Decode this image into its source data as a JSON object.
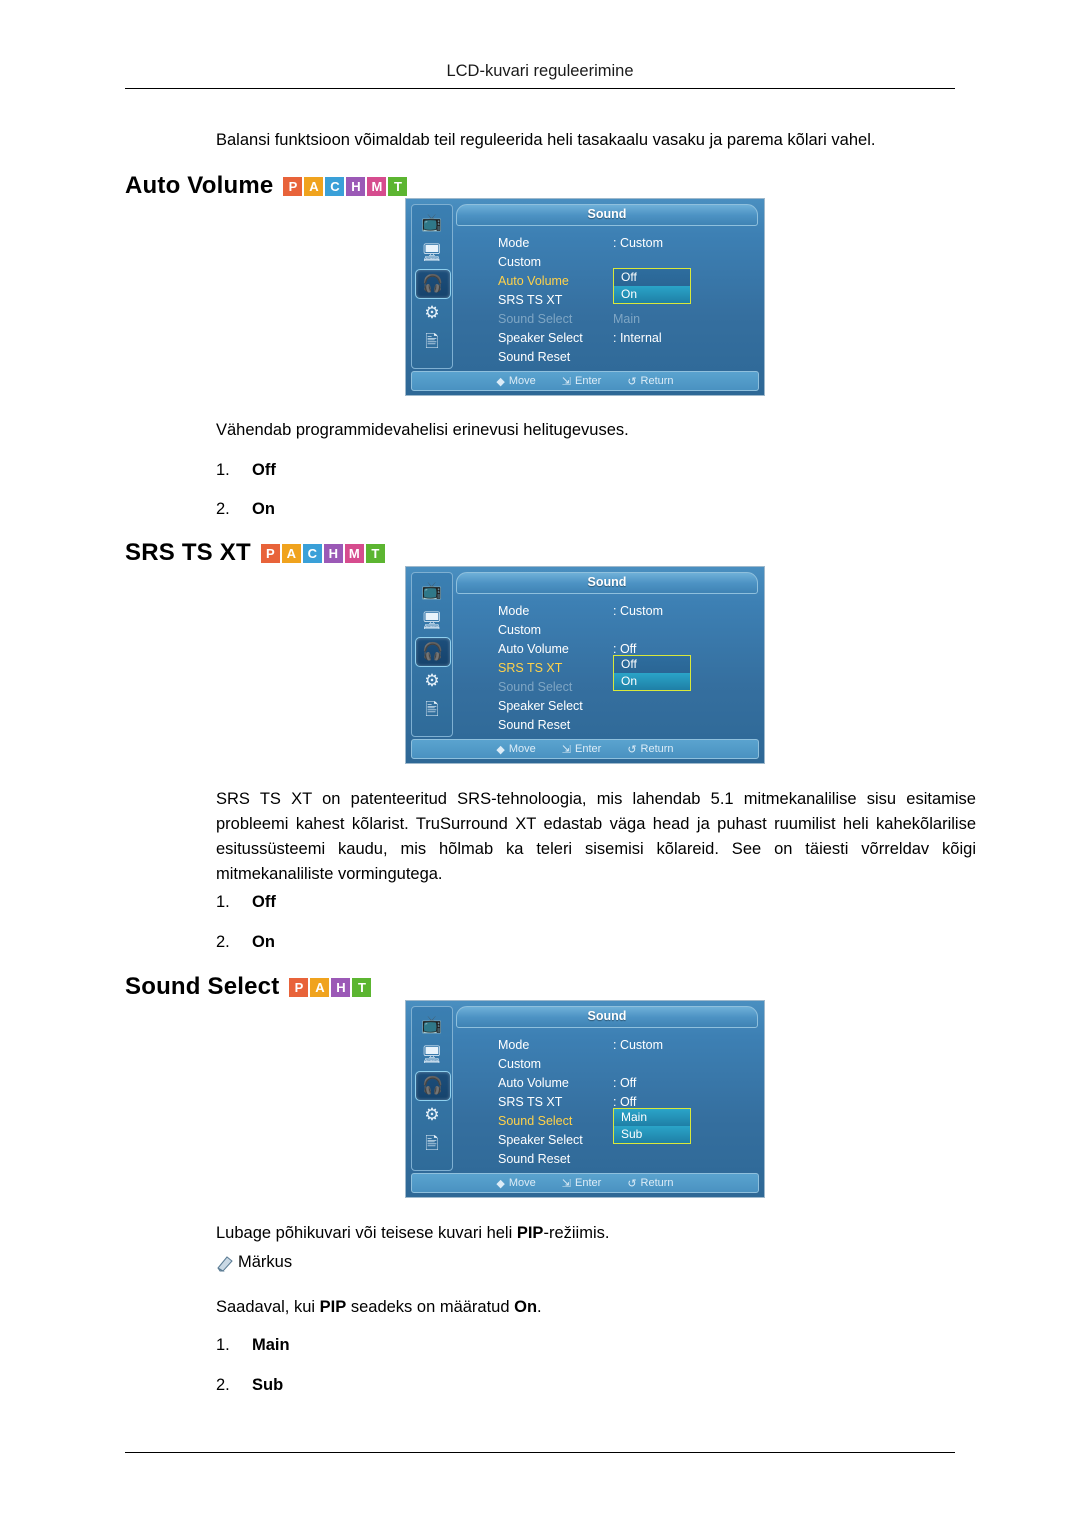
{
  "header": {
    "title": "LCD-kuvari reguleerimine"
  },
  "intro": "Balansi funktsioon võimaldab teil reguleerida heli tasakaalu vasaku ja parema kõlari vahel.",
  "badge_colors": {
    "P": "#e8633a",
    "A": "#f0a31e",
    "C": "#3aa0d8",
    "H": "#9b59b6",
    "M": "#d64c8e",
    "T": "#5cb531"
  },
  "sections": [
    {
      "id": "auto-volume",
      "heading": "Auto Volume",
      "badges": [
        "P",
        "A",
        "C",
        "H",
        "M",
        "T"
      ],
      "osd": {
        "title": "Sound",
        "rows": [
          {
            "label": "Mode",
            "value": ": Custom",
            "state": "normal"
          },
          {
            "label": "Custom",
            "value": "",
            "state": "normal"
          },
          {
            "label": "Auto Volume",
            "value": "",
            "state": "active"
          },
          {
            "label": "SRS TS XT",
            "value": "",
            "state": "normal"
          },
          {
            "label": "Sound Select",
            "value": "Main",
            "state": "dim"
          },
          {
            "label": "Speaker Select",
            "value": ": Internal",
            "state": "normal"
          },
          {
            "label": "Sound Reset",
            "value": "",
            "state": "normal"
          }
        ],
        "popup": {
          "top_row": 2,
          "options": [
            "Off",
            "On"
          ],
          "highlight": 1
        },
        "footer": [
          "Move",
          "Enter",
          "Return"
        ],
        "selected_icon": 2
      },
      "description": "Vähendab programmidevahelisi erinevusi helitugevuses.",
      "options": [
        {
          "num": "1.",
          "label": "Off"
        },
        {
          "num": "2.",
          "label": "On"
        }
      ]
    },
    {
      "id": "srs-ts-xt",
      "heading": "SRS TS XT",
      "badges": [
        "P",
        "A",
        "C",
        "H",
        "M",
        "T"
      ],
      "osd": {
        "title": "Sound",
        "rows": [
          {
            "label": "Mode",
            "value": ": Custom",
            "state": "normal"
          },
          {
            "label": "Custom",
            "value": "",
            "state": "normal"
          },
          {
            "label": "Auto Volume",
            "value": ": Off",
            "state": "normal"
          },
          {
            "label": "SRS TS XT",
            "value": ":",
            "state": "active"
          },
          {
            "label": "Sound Select",
            "value": ":",
            "state": "dim"
          },
          {
            "label": "Speaker Select",
            "value": "",
            "state": "normal"
          },
          {
            "label": "Sound Reset",
            "value": "",
            "state": "normal"
          }
        ],
        "popup": {
          "top_row": 3,
          "options": [
            "Off",
            "On"
          ],
          "highlight": 1
        },
        "footer": [
          "Move",
          "Enter",
          "Return"
        ],
        "selected_icon": 2
      },
      "description": "SRS TS XT on patenteeritud SRS-tehnoloogia, mis lahendab 5.1 mitmekanalilise sisu esitamise probleemi kahest kõlarist. TruSurround XT edastab väga head ja puhast ruumilist heli kahekõlarilise esitussüsteemi kaudu, mis hõlmab ka teleri sisemisi kõlareid. See on täiesti võrreldav kõigi mitmekanaliliste vormingutega.",
      "options": [
        {
          "num": "1.",
          "label": "Off"
        },
        {
          "num": "2.",
          "label": "On"
        }
      ]
    },
    {
      "id": "sound-select",
      "heading": "Sound Select",
      "badges": [
        "P",
        "A",
        "H",
        "T"
      ],
      "osd": {
        "title": "Sound",
        "rows": [
          {
            "label": "Mode",
            "value": ": Custom",
            "state": "normal"
          },
          {
            "label": "Custom",
            "value": "",
            "state": "normal"
          },
          {
            "label": "Auto Volume",
            "value": ": Off",
            "state": "normal"
          },
          {
            "label": "SRS TS XT",
            "value": ": Off",
            "state": "normal"
          },
          {
            "label": "Sound Select",
            "value": "",
            "state": "active"
          },
          {
            "label": "Speaker Select",
            "value": "",
            "state": "normal"
          },
          {
            "label": "Sound Reset",
            "value": "",
            "state": "normal"
          }
        ],
        "popup": {
          "top_row": 4,
          "options": [
            "Main",
            "Sub"
          ],
          "highlight": 1
        },
        "footer": [
          "Move",
          "Enter",
          "Return"
        ],
        "selected_icon": 2
      },
      "description_parts": [
        {
          "text": "Lubage põhikuvari või teisese kuvari heli ",
          "bold": false
        },
        {
          "text": "PIP",
          "bold": true
        },
        {
          "text": "-režiimis.",
          "bold": false
        }
      ],
      "note_label": "Märkus",
      "note_parts": [
        {
          "text": "Saadaval, kui ",
          "bold": false
        },
        {
          "text": "PIP",
          "bold": true
        },
        {
          "text": " seadeks on määratud ",
          "bold": false
        },
        {
          "text": "On",
          "bold": true
        },
        {
          "text": ".",
          "bold": false
        }
      ],
      "options": [
        {
          "num": "1.",
          "label": "Main"
        },
        {
          "num": "2.",
          "label": "Sub"
        }
      ]
    }
  ],
  "osd_icons": [
    "picture-icon",
    "display-icon",
    "sound-icon",
    "setup-icon",
    "multi-control-icon"
  ],
  "footer_icons": [
    "move-icon",
    "enter-icon",
    "return-icon"
  ]
}
